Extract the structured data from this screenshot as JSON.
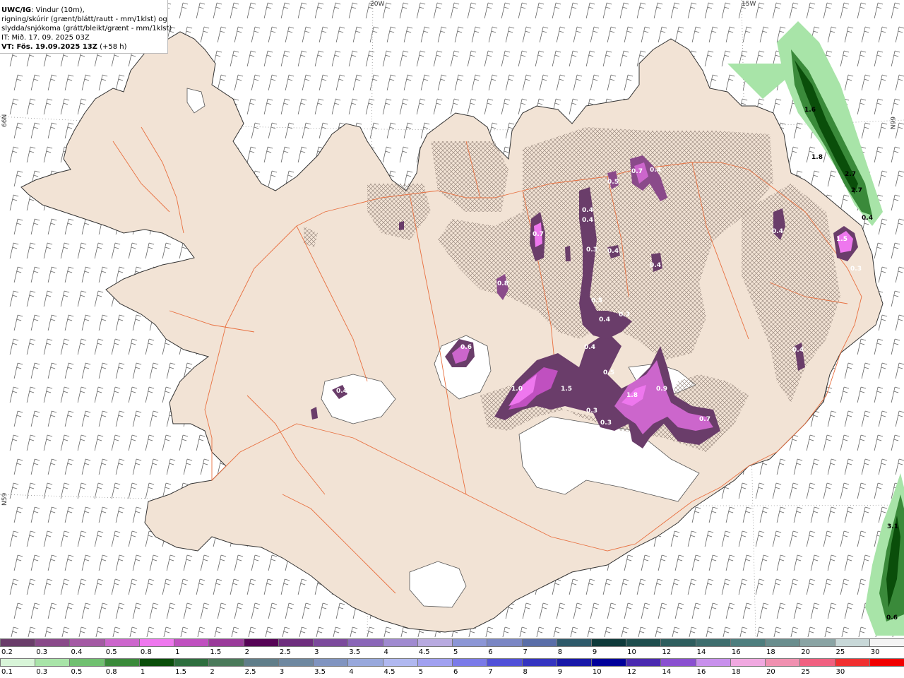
{
  "header": {
    "title_bold": "UWC/IG",
    "title_rest": ": Vindur (10m),",
    "line2": "rigning/skúrir (grænt/blátt/rautt - mm/1klst) og",
    "line3": "slydda/snjókoma (grátt/bleikt/grænt - mm/1klst)",
    "line4": "IT: Mið. 17. 09. 2025 03Z",
    "line5_bold": "VT: Fös. 19.09.2025 13Z",
    "line5_rest": " (+58 h)"
  },
  "grid_labels": {
    "lon_left": "20W",
    "lon_right": "15W",
    "lat_upper_left": "66N",
    "lat_lower_left": "N59",
    "lat_upper_right": "66N"
  },
  "precip_labels": [
    {
      "text": "0.7"
    },
    {
      "text": "0.4"
    },
    {
      "text": "0.5"
    },
    {
      "text": "0.4"
    },
    {
      "text": "0.4"
    },
    {
      "text": "0.3"
    },
    {
      "text": "0.4"
    },
    {
      "text": "0.7"
    },
    {
      "text": "0.8"
    },
    {
      "text": "0.4"
    },
    {
      "text": "0.5"
    },
    {
      "text": "0.4"
    },
    {
      "text": "0.3"
    },
    {
      "text": "0.4"
    },
    {
      "text": "0.6"
    },
    {
      "text": "0.4"
    },
    {
      "text": "1.0"
    },
    {
      "text": "1.5"
    },
    {
      "text": "0.5"
    },
    {
      "text": "0.3"
    },
    {
      "text": "0.3"
    },
    {
      "text": "1.8"
    },
    {
      "text": "0.9"
    },
    {
      "text": "0.7"
    },
    {
      "text": "0.4"
    },
    {
      "text": "0.4"
    },
    {
      "text": "1.5"
    },
    {
      "text": "0.3"
    },
    {
      "text": "1.6"
    },
    {
      "text": "1.8"
    },
    {
      "text": "2.7"
    },
    {
      "text": "2.7"
    },
    {
      "text": "0.4"
    },
    {
      "text": "3.1"
    },
    {
      "text": "0.6"
    }
  ],
  "legend_snow": {
    "ticks": [
      "0.2",
      "0.3",
      "0.4",
      "0.5",
      "0.8",
      "1",
      "1.5",
      "2",
      "2.5",
      "3",
      "3.5",
      "4",
      "4.5",
      "5",
      "6",
      "7",
      "8",
      "9",
      "10",
      "12",
      "14",
      "16",
      "18",
      "20",
      "25",
      "30"
    ],
    "colors": [
      "#6a3d6a",
      "#8a4a8a",
      "#a45aa4",
      "#cc66cc",
      "#ee77ee",
      "#c050c0",
      "#9a3a9a",
      "#560356",
      "#6e2e7e",
      "#7c4a9c",
      "#8a66b8",
      "#a08ad0",
      "#b8aae0",
      "#8c96d6",
      "#7a86c4",
      "#5a6ea8",
      "#2e5a6a",
      "#0e3a3a",
      "#1e4e4e",
      "#2e5e5e",
      "#3e6e6e",
      "#4e7e7e",
      "#6a8e8e",
      "#8aa4a4",
      "#c8d8d8",
      "#f4f4f4"
    ]
  },
  "legend_rain": {
    "ticks": [
      "0.1",
      "0.3",
      "0.5",
      "0.8",
      "1",
      "1.5",
      "2",
      "2.5",
      "3",
      "3.5",
      "4",
      "4.5",
      "5",
      "6",
      "7",
      "8",
      "9",
      "10",
      "12",
      "14",
      "16",
      "18",
      "20",
      "25",
      "30"
    ],
    "colors": [
      "#d8f5d8",
      "#a8e4a8",
      "#70c070",
      "#3a8a3a",
      "#0a4e0a",
      "#2e6e3e",
      "#4a7a5a",
      "#607e8a",
      "#6e88a0",
      "#8094c0",
      "#98a8dc",
      "#b0b8f0",
      "#a0a0f0",
      "#7a7ae8",
      "#5050d8",
      "#3434c0",
      "#1818a8",
      "#00009a",
      "#4a2ab0",
      "#8a50d0",
      "#c890ec",
      "#f0a8e0",
      "#f090b0",
      "#f06080",
      "#f03030",
      "#f00000"
    ]
  },
  "colors": {
    "land": "#f2e3d5",
    "roads": "#e87040",
    "coast": "#333333",
    "wind_barb": "#666666"
  }
}
